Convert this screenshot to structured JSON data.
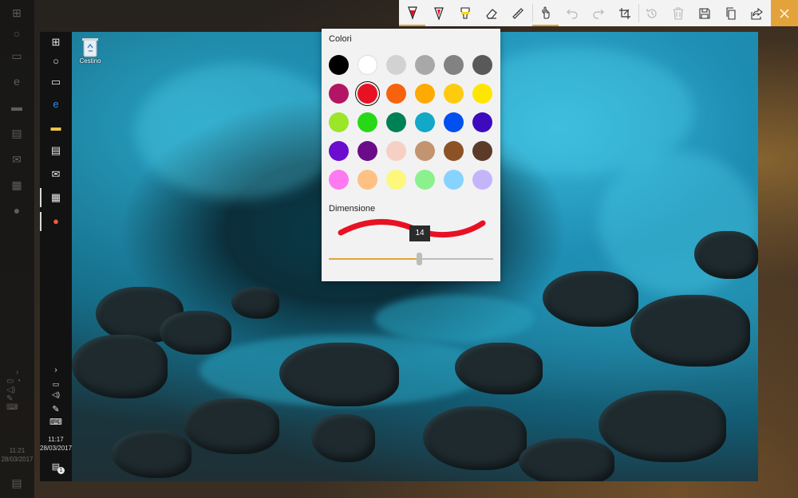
{
  "desktop": {
    "recycle_bin_label": "Cestino"
  },
  "outer_taskbar": {
    "time": "11:21",
    "date": "28/03/2017"
  },
  "inner_taskbar": {
    "time": "11:17",
    "date": "28/03/2017",
    "notification_count": "1"
  },
  "toolbar": {
    "tools": [
      {
        "name": "ballpoint-pen",
        "color": "#e81123",
        "selected": true
      },
      {
        "name": "pencil",
        "color": "#e81123",
        "selected": false
      },
      {
        "name": "highlighter",
        "color": "#ffd800",
        "selected": false
      },
      {
        "name": "eraser",
        "selected": false
      },
      {
        "name": "ruler",
        "selected": false
      },
      {
        "name": "touch-writing",
        "selected": true
      },
      {
        "name": "undo",
        "enabled": false
      },
      {
        "name": "redo",
        "enabled": false
      },
      {
        "name": "crop",
        "enabled": true
      },
      {
        "name": "replay",
        "enabled": false
      },
      {
        "name": "clear-all",
        "enabled": false
      },
      {
        "name": "save",
        "enabled": true
      },
      {
        "name": "copy",
        "enabled": true
      },
      {
        "name": "share",
        "enabled": true
      },
      {
        "name": "close",
        "enabled": true
      }
    ],
    "accent": "#e3a33a"
  },
  "color_popup": {
    "title": "Colori",
    "size_title": "Dimensione",
    "size_value": "14",
    "size_fraction": 0.55,
    "selected_color": "#e81123",
    "colors": [
      [
        "#000000",
        "#ffffff",
        "#d2d2d2",
        "#a8a8a8",
        "#828282",
        "#595959"
      ],
      [
        "#b31564",
        "#e81123",
        "#f7630c",
        "#ffaa00",
        "#ffcb0f",
        "#ffe600"
      ],
      [
        "#9ce62a",
        "#27d816",
        "#008055",
        "#12a8c7",
        "#0050ef",
        "#3d0bbd"
      ],
      [
        "#6a0dcf",
        "#6b0b8a",
        "#f6d0c4",
        "#c29470",
        "#8c5226",
        "#5c3a2a"
      ],
      [
        "#ff7af0",
        "#ffc084",
        "#fdf77b",
        "#8af18c",
        "#87d3ff",
        "#c4b5fb"
      ]
    ]
  }
}
